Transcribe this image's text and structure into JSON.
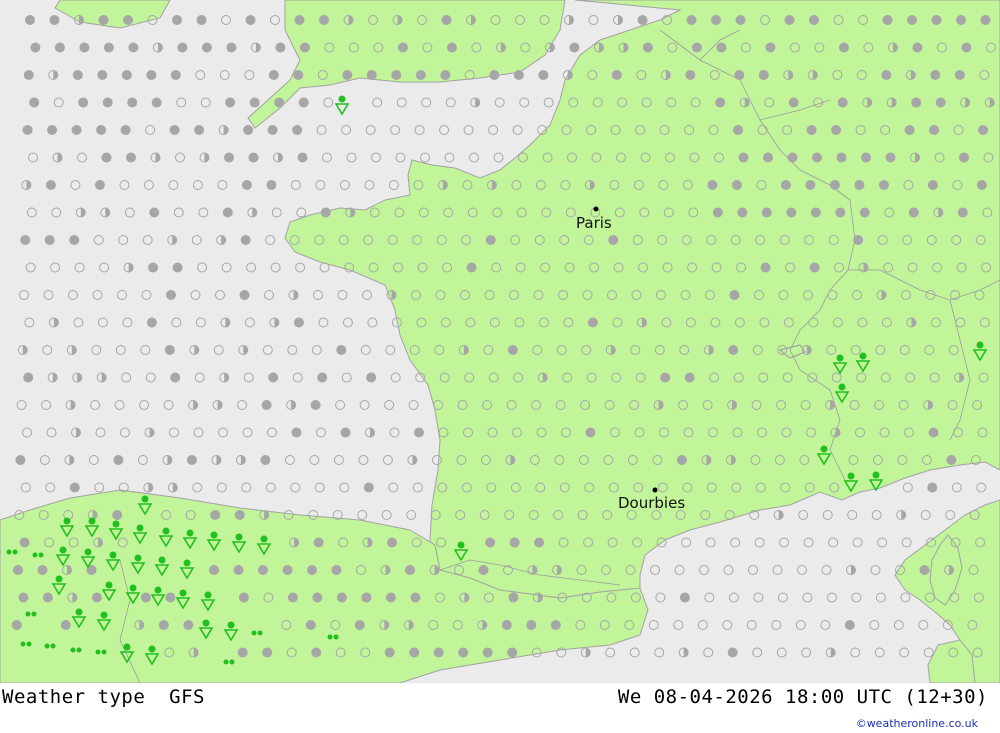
{
  "map": {
    "colors": {
      "sea": "#ebebeb",
      "land": "#c2f59a",
      "cloud": "#a6a6a6",
      "rain": "#20c020"
    },
    "cities": [
      {
        "name": "Paris"
      },
      {
        "name": "Dourbies"
      }
    ],
    "legend_symbols": [
      "clear-circle",
      "half-cloud-circle",
      "overcast-dot",
      "light-rain-triangle",
      "drizzle-dots"
    ]
  },
  "footer": {
    "title": "Weather type  GFS",
    "datetime": "We 08-04-2026 18:00 UTC (12+30)",
    "credit": "©weatheronline.co.uk"
  }
}
